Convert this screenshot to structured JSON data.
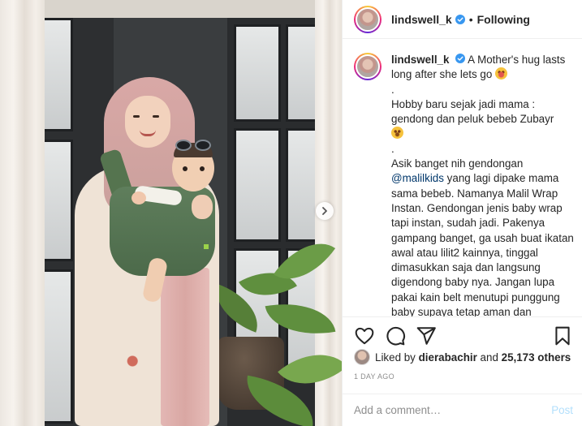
{
  "header": {
    "username": "lindswell_k",
    "separator": "•",
    "follow_status": "Following"
  },
  "caption": {
    "username": "lindswell_k",
    "lines": [
      "A Mother's hug lasts long after she lets go",
      ".",
      "Hobby baru sejak jadi mama : gendong dan peluk bebeb Zubayr",
      ".",
      "Asik banget nih gendongan",
      "@malilkids",
      "yang lagi dipake mama sama bebeb. Namanya Malil Wrap Instan. Gendongan jenis baby wrap tapi instan, sudah jadi. Pakenya gampang banget, ga usah buat ikatan awal atau lilit2 kainnya, tinggal dimasukkan saja dan langsung digendong baby nya. Jangan lupa pakai kain belt menutupi punggung baby supaya tetap aman dan nyaman."
    ]
  },
  "likes": {
    "prefix": "Liked by",
    "liker": "dierabachir",
    "connector": "and",
    "others": "25,173 others"
  },
  "timestamp": "1 DAY AGO",
  "comment": {
    "placeholder": "Add a comment…",
    "post_label": "Post"
  },
  "icons": {
    "like": "heart-icon",
    "comment": "comment-icon",
    "share": "paper-plane-icon",
    "save": "bookmark-icon",
    "next": "chevron-right-icon",
    "verified": "verified-badge-icon"
  },
  "colors": {
    "verified": "#3897f0",
    "mention": "#00376b",
    "post_disabled": "#b2dffc",
    "muted": "#8e8e8e"
  }
}
